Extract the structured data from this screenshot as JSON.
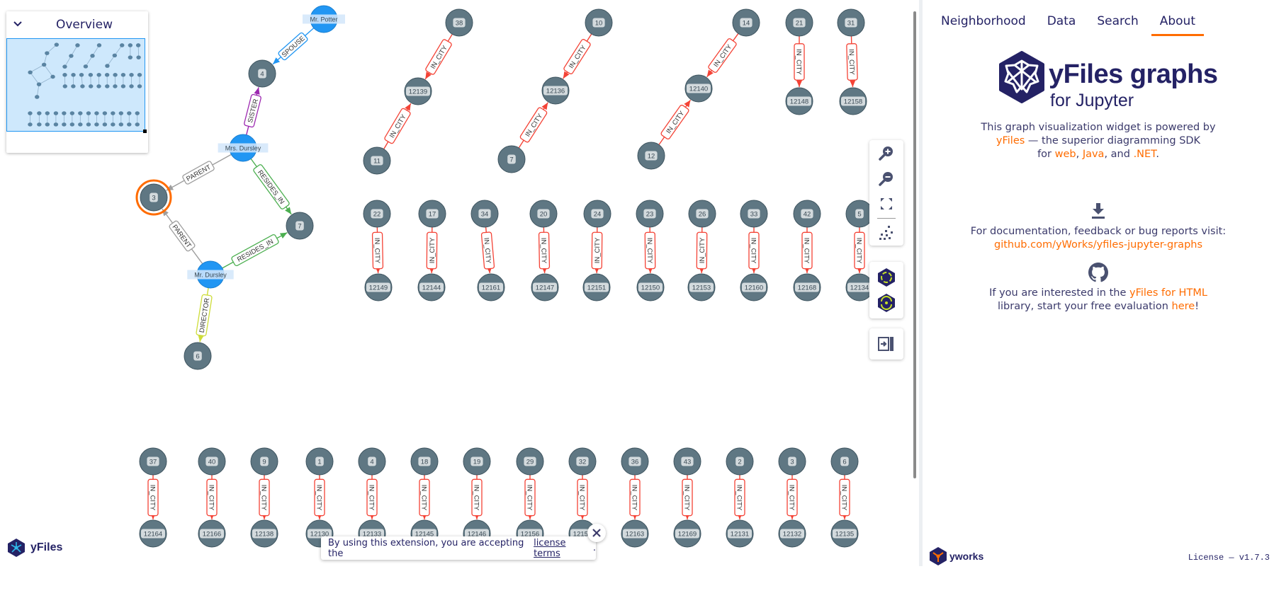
{
  "overview": {
    "title": "Overview",
    "collapse_icon": "chevron-down-icon"
  },
  "graph": {
    "selected_node": "3",
    "colors": {
      "node": "#5f7783",
      "person": "#2196f3",
      "selection": "#ff6c00",
      "in_city": "#f44336",
      "spouse": "#2196f3",
      "sister": "#9c27b0",
      "parent": "#9e9e9e",
      "resides_in": "#4caf50",
      "director": "#cddc39"
    },
    "nodes": [
      {
        "label": "Mr. Potter",
        "kind": "person"
      },
      {
        "label": "4"
      },
      {
        "label": "Mrs. Dursley",
        "kind": "person"
      },
      {
        "label": "3"
      },
      {
        "label": "7"
      },
      {
        "label": "Mr. Dursley",
        "kind": "person"
      },
      {
        "label": "6"
      },
      {
        "label": "38"
      },
      {
        "label": "12139"
      },
      {
        "label": "11"
      },
      {
        "label": "10"
      },
      {
        "label": "12136"
      },
      {
        "label": "7"
      },
      {
        "label": "14"
      },
      {
        "label": "12140"
      },
      {
        "label": "12"
      },
      {
        "label": "21"
      },
      {
        "label": "12148"
      },
      {
        "label": "31"
      },
      {
        "label": "12158"
      },
      {
        "label": "22"
      },
      {
        "label": "12149"
      },
      {
        "label": "17"
      },
      {
        "label": "12144"
      },
      {
        "label": "34"
      },
      {
        "label": "12161"
      },
      {
        "label": "20"
      },
      {
        "label": "12147"
      },
      {
        "label": "24"
      },
      {
        "label": "12151"
      },
      {
        "label": "23"
      },
      {
        "label": "12150"
      },
      {
        "label": "26"
      },
      {
        "label": "12153"
      },
      {
        "label": "33"
      },
      {
        "label": "12160"
      },
      {
        "label": "42"
      },
      {
        "label": "12168"
      },
      {
        "label": "5"
      },
      {
        "label": "12134"
      },
      {
        "label": "37"
      },
      {
        "label": "12164"
      },
      {
        "label": "40"
      },
      {
        "label": "12166"
      },
      {
        "label": "9"
      },
      {
        "label": "12138"
      },
      {
        "label": "1"
      },
      {
        "label": "12130"
      },
      {
        "label": "4"
      },
      {
        "label": "12133"
      },
      {
        "label": "18"
      },
      {
        "label": "12145"
      },
      {
        "label": "19"
      },
      {
        "label": "12146"
      },
      {
        "label": "29"
      },
      {
        "label": "12156"
      },
      {
        "label": "32"
      },
      {
        "label": "12159"
      },
      {
        "label": "36"
      },
      {
        "label": "12163"
      },
      {
        "label": "43"
      },
      {
        "label": "12169"
      },
      {
        "label": "2"
      },
      {
        "label": "12131"
      },
      {
        "label": "3"
      },
      {
        "label": "12132"
      },
      {
        "label": "6"
      },
      {
        "label": "12135"
      }
    ],
    "edges": [
      {
        "source": 0,
        "target": 1,
        "label": "SPOUSE",
        "type": "spouse"
      },
      {
        "source": 2,
        "target": 1,
        "label": "SISTER",
        "type": "sister"
      },
      {
        "source": 2,
        "target": 3,
        "label": "PARENT",
        "type": "parent"
      },
      {
        "source": 5,
        "target": 3,
        "label": "PARENT",
        "type": "parent"
      },
      {
        "source": 2,
        "target": 4,
        "label": "RESIDES_IN",
        "type": "resides_in"
      },
      {
        "source": 5,
        "target": 4,
        "label": "RESIDES_IN",
        "type": "resides_in"
      },
      {
        "source": 5,
        "target": 6,
        "label": "DIRECTOR",
        "type": "director"
      },
      {
        "source": 7,
        "target": 8,
        "label": "IN_CITY",
        "type": "in_city"
      },
      {
        "source": 9,
        "target": 8,
        "label": "IN_CITY",
        "type": "in_city"
      },
      {
        "source": 10,
        "target": 11,
        "label": "IN_CITY",
        "type": "in_city"
      },
      {
        "source": 12,
        "target": 11,
        "label": "IN_CITY",
        "type": "in_city"
      },
      {
        "source": 13,
        "target": 14,
        "label": "IN_CITY",
        "type": "in_city"
      },
      {
        "source": 15,
        "target": 14,
        "label": "IN_CITY",
        "type": "in_city"
      },
      {
        "source": 16,
        "target": 17,
        "label": "IN_CITY",
        "type": "in_city"
      },
      {
        "source": 18,
        "target": 19,
        "label": "IN_CITY",
        "type": "in_city"
      },
      {
        "source": 20,
        "target": 21,
        "label": "IN_CITY",
        "type": "in_city"
      },
      {
        "source": 22,
        "target": 23,
        "label": "IN_CITY",
        "type": "in_city"
      },
      {
        "source": 24,
        "target": 25,
        "label": "IN_CITY",
        "type": "in_city"
      },
      {
        "source": 26,
        "target": 27,
        "label": "IN_CITY",
        "type": "in_city"
      },
      {
        "source": 28,
        "target": 29,
        "label": "IN_CITY",
        "type": "in_city"
      },
      {
        "source": 30,
        "target": 31,
        "label": "IN_CITY",
        "type": "in_city"
      },
      {
        "source": 32,
        "target": 33,
        "label": "IN_CITY",
        "type": "in_city"
      },
      {
        "source": 34,
        "target": 35,
        "label": "IN_CITY",
        "type": "in_city"
      },
      {
        "source": 36,
        "target": 37,
        "label": "IN_CITY",
        "type": "in_city"
      },
      {
        "source": 38,
        "target": 39,
        "label": "IN_CITY",
        "type": "in_city"
      },
      {
        "source": 40,
        "target": 41,
        "label": "IN_CITY",
        "type": "in_city"
      },
      {
        "source": 42,
        "target": 43,
        "label": "IN_CITY",
        "type": "in_city"
      },
      {
        "source": 44,
        "target": 45,
        "label": "IN_CITY",
        "type": "in_city"
      },
      {
        "source": 46,
        "target": 47,
        "label": "IN_CITY",
        "type": "in_city"
      },
      {
        "source": 48,
        "target": 49,
        "label": "IN_CITY",
        "type": "in_city"
      },
      {
        "source": 50,
        "target": 51,
        "label": "IN_CITY",
        "type": "in_city"
      },
      {
        "source": 52,
        "target": 53,
        "label": "IN_CITY",
        "type": "in_city"
      },
      {
        "source": 54,
        "target": 55,
        "label": "IN_CITY",
        "type": "in_city"
      },
      {
        "source": 56,
        "target": 57,
        "label": "IN_CITY",
        "type": "in_city"
      },
      {
        "source": 58,
        "target": 59,
        "label": "IN_CITY",
        "type": "in_city"
      },
      {
        "source": 60,
        "target": 61,
        "label": "IN_CITY",
        "type": "in_city"
      },
      {
        "source": 62,
        "target": 63,
        "label": "IN_CITY",
        "type": "in_city"
      },
      {
        "source": 64,
        "target": 65,
        "label": "IN_CITY",
        "type": "in_city"
      },
      {
        "source": 66,
        "target": 67,
        "label": "IN_CITY",
        "type": "in_city"
      }
    ]
  },
  "toolbar": {
    "buttons": [
      "zoom-in",
      "zoom-out",
      "fit-content",
      "layout",
      "hierarchic-layout",
      "radial-layout",
      "toggle-sidebar"
    ]
  },
  "sidebar": {
    "tabs": [
      {
        "label": "Neighborhood"
      },
      {
        "label": "Data"
      },
      {
        "label": "Search"
      },
      {
        "label": "About",
        "active": true
      }
    ],
    "brand_title": "yFiles graphs",
    "brand_subtitle": "for Jupyter",
    "powered": {
      "line1": "This graph visualization widget is powered by",
      "yfiles_link": "yFiles",
      "line2_rest": " — the superior diagramming SDK",
      "for": "for ",
      "web": "web",
      "comma1": ", ",
      "java": "Java",
      "and": ", and ",
      "net": ".NET",
      "period": "."
    },
    "docs": {
      "text": "For documentation, feedback or bug reports visit:",
      "link": "github.com/yWorks/yfiles-jupyter-graphs"
    },
    "eval": {
      "pre": "If you are interested in the ",
      "link": "yFiles for HTML",
      "line2_pre": "library, start your free evaluation ",
      "here": "here",
      "excl": "!"
    },
    "footer": {
      "yworks": "yworks",
      "license": "License — v1.7.3"
    },
    "accent": "#ff6c00",
    "text_color": "#242265"
  },
  "canvas_logo": "yFiles",
  "toast": {
    "text": "By using this extension, you are accepting the ",
    "link": "license terms",
    "period": "."
  }
}
